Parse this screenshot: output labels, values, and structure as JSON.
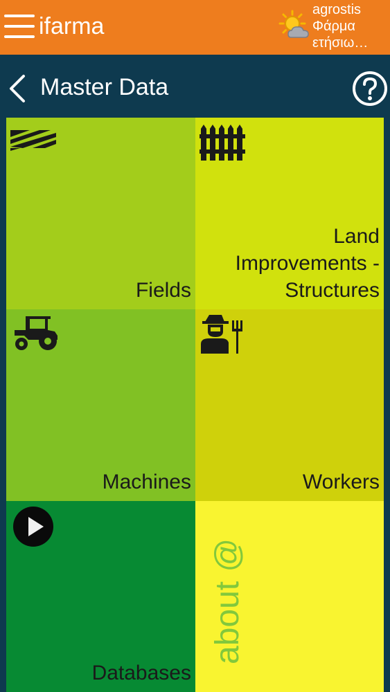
{
  "header": {
    "app_name": "ifarma",
    "farm_line1": "agrostis",
    "farm_line2": "Φάρμα",
    "farm_line3": "ετήσιω…",
    "icons": [
      "menu-icon",
      "weather-partly-cloudy-icon"
    ],
    "background_color": "#ee7d1e"
  },
  "navbar": {
    "title": "Master Data",
    "icons": [
      "back-chevron-icon",
      "help-icon"
    ],
    "background_color": "#0e3a4f"
  },
  "tiles": [
    {
      "label": "Fields",
      "icon": "field-rows-icon",
      "color": "#a3cd1b"
    },
    {
      "label": "Land Improvements - Structures",
      "icon": "fence-icon",
      "color": "#d1e10d"
    },
    {
      "label": "Machines",
      "icon": "tractor-icon",
      "color": "#81c124"
    },
    {
      "label": "Workers",
      "icon": "farmer-icon",
      "color": "#cfd10b"
    },
    {
      "label": "Databases",
      "icon": "play-icon",
      "color": "#078a33"
    },
    {
      "label": "about @",
      "icon": "about-icon",
      "color": "#f9f430"
    }
  ]
}
